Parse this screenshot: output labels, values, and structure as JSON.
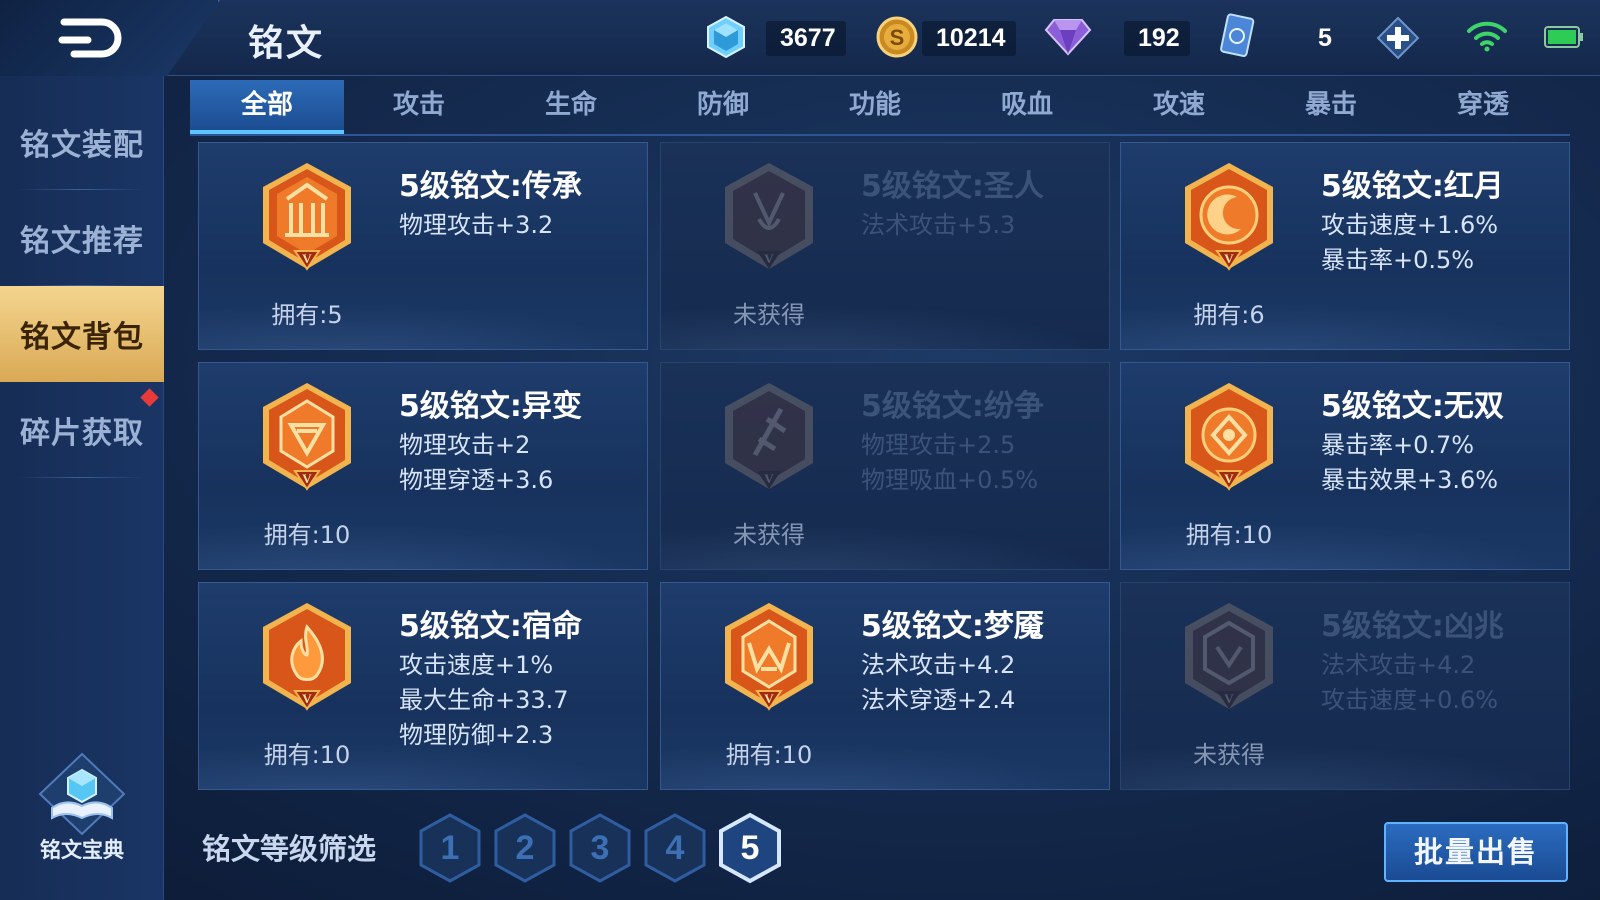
{
  "header": {
    "title": "铭文",
    "currencies": [
      {
        "name": "crystal-icon",
        "value": "3677"
      },
      {
        "name": "gold-coin-icon",
        "value": "10214"
      },
      {
        "name": "diamond-icon",
        "value": "192"
      },
      {
        "name": "card-ticket-icon",
        "value": "5"
      }
    ]
  },
  "sidebar": {
    "items": [
      {
        "label": "铭文装配"
      },
      {
        "label": "铭文推荐"
      },
      {
        "label": "铭文背包"
      },
      {
        "label": "碎片获取"
      }
    ],
    "active_index": 2,
    "codex_label": "铭文宝典"
  },
  "tabs": {
    "items": [
      "全部",
      "攻击",
      "生命",
      "防御",
      "功能",
      "吸血",
      "攻速",
      "暴击",
      "穿透"
    ],
    "active_index": 0
  },
  "cards": [
    {
      "name": "5级铭文:传承",
      "stats": [
        "物理攻击+3.2"
      ],
      "owned": "拥有:5",
      "locked": false,
      "emblem": "inheritance-emblem-icon"
    },
    {
      "name": "5级铭文:圣人",
      "stats": [
        "法术攻击+5.3"
      ],
      "owned": "未获得",
      "locked": true,
      "emblem": "sage-emblem-icon"
    },
    {
      "name": "5级铭文:红月",
      "stats": [
        "攻击速度+1.6%",
        "暴击率+0.5%"
      ],
      "owned": "拥有:6",
      "locked": false,
      "emblem": "red-moon-emblem-icon"
    },
    {
      "name": "5级铭文:异变",
      "stats": [
        "物理攻击+2",
        "物理穿透+3.6"
      ],
      "owned": "拥有:10",
      "locked": false,
      "emblem": "mutation-emblem-icon"
    },
    {
      "name": "5级铭文:纷争",
      "stats": [
        "物理攻击+2.5",
        "物理吸血+0.5%"
      ],
      "owned": "未获得",
      "locked": true,
      "emblem": "strife-emblem-icon"
    },
    {
      "name": "5级铭文:无双",
      "stats": [
        "暴击率+0.7%",
        "暴击效果+3.6%"
      ],
      "owned": "拥有:10",
      "locked": false,
      "emblem": "unrivaled-emblem-icon"
    },
    {
      "name": "5级铭文:宿命",
      "stats": [
        "攻击速度+1%",
        "最大生命+33.7",
        "物理防御+2.3"
      ],
      "owned": "拥有:10",
      "locked": false,
      "emblem": "fate-emblem-icon"
    },
    {
      "name": "5级铭文:梦魇",
      "stats": [
        "法术攻击+4.2",
        "法术穿透+2.4"
      ],
      "owned": "拥有:10",
      "locked": false,
      "emblem": "nightmare-emblem-icon"
    },
    {
      "name": "5级铭文:凶兆",
      "stats": [
        "法术攻击+4.2",
        "攻击速度+0.6%"
      ],
      "owned": "未获得",
      "locked": true,
      "emblem": "omen-emblem-icon"
    }
  ],
  "filter": {
    "label": "铭文等级筛选",
    "levels": [
      "1",
      "2",
      "3",
      "4",
      "5"
    ],
    "active_level": "5"
  },
  "sell_button": "批量出售",
  "colors": {
    "accent": "#5ec6ff",
    "active_sidebar": "#e3b865",
    "emblem_orange": "#e06a1c",
    "emblem_gold": "#f5c66a"
  }
}
